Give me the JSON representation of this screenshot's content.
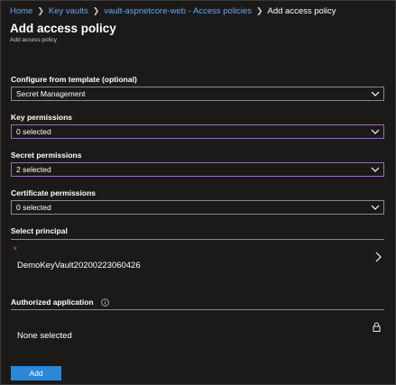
{
  "breadcrumb": {
    "items": [
      {
        "label": "Home"
      },
      {
        "label": "Key vaults"
      },
      {
        "label": "vault-aspnetcore-web - Access policies"
      },
      {
        "label": "Add access policy"
      }
    ]
  },
  "header": {
    "title": "Add access policy",
    "subtitle": "Add access policy"
  },
  "form": {
    "template": {
      "label": "Configure from template (optional)",
      "value": "Secret Management"
    },
    "key_permissions": {
      "label": "Key permissions",
      "value": "0 selected"
    },
    "secret_permissions": {
      "label": "Secret permissions",
      "value": "2 selected"
    },
    "certificate_permissions": {
      "label": "Certificate permissions",
      "value": "0 selected"
    },
    "principal": {
      "label": "Select principal",
      "required_mark": "*",
      "value": "DemoKeyVault20200223060426"
    },
    "authorized_application": {
      "label": "Authorized application",
      "value": "None selected"
    },
    "add_label": "Add"
  },
  "colors": {
    "background": "#1b1a19",
    "link": "#62a8ea",
    "primary_button": "#2b88d8",
    "focus_border": "#9b6bb8",
    "required": "#f1707b"
  },
  "icons": [
    "chevron-right-icon",
    "chevron-down-icon",
    "info-icon",
    "lock-icon"
  ]
}
